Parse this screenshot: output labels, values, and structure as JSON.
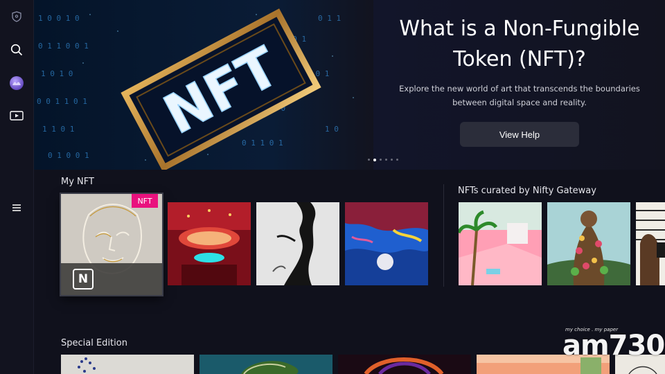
{
  "sidebar": {
    "items": [
      {
        "icon": "shield-icon"
      },
      {
        "icon": "search-icon"
      },
      {
        "icon": "profile-avatar-icon"
      },
      {
        "icon": "media-play-icon"
      },
      {
        "icon": "menu-icon"
      }
    ]
  },
  "hero": {
    "title": "What is a Non-Fungible Token (NFT)?",
    "subtitle": "Explore the new world of art that transcends the boundaries between digital space and reality.",
    "button_label": "View Help",
    "image_text": "NFT",
    "carousel_total": 6,
    "carousel_active": 2
  },
  "my_nft": {
    "title": "My NFT",
    "badge": "NFT",
    "logo_letter": "N"
  },
  "curated": {
    "title": "NFTs curated by Nifty Gateway"
  },
  "special": {
    "title": "Special Edition"
  },
  "watermark": {
    "text": "am730",
    "tagline": "my choice . my paper"
  },
  "colors": {
    "background": "#10111c",
    "badge": "#e9127e",
    "button": "#2b2d3a"
  }
}
